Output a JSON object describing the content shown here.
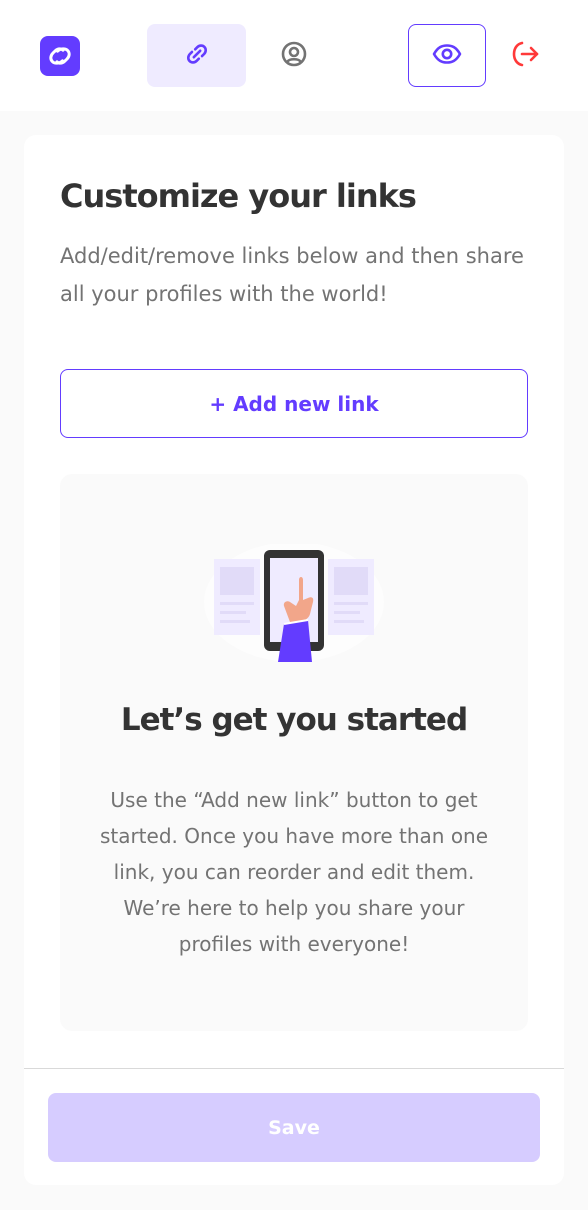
{
  "header": {
    "logo_icon": "devlinks-logo-icon",
    "tabs": [
      {
        "icon": "link-icon",
        "active": true
      },
      {
        "icon": "profile-icon",
        "active": false
      }
    ],
    "preview_icon": "eye-icon",
    "logout_icon": "logout-icon"
  },
  "main": {
    "title": "Customize your links",
    "description": "Add/edit/remove links below and then share all your profiles with the world!",
    "add_link_label": "+ Add new link",
    "empty_state": {
      "illustration": "phone-tap-illustration",
      "title": "Let’s get you started",
      "body": "Use the “Add new link” button to get started. Once you have more than one link, you can reorder and edit them. We’re here to help you share your profiles with everyone!"
    },
    "save_label": "Save"
  },
  "colors": {
    "accent": "#633CFF",
    "accent_light": "#EFEBFF",
    "save_disabled": "#D6CCFF",
    "logout": "#FF3939",
    "text_dark": "#333333",
    "text_muted": "#737373"
  }
}
